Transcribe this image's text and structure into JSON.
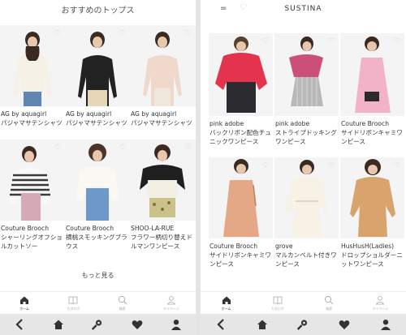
{
  "left": {
    "title": "おすすめのトップス",
    "products": [
      {
        "brand": "AG by aquagirl",
        "name": "パジャマサテンシャツ"
      },
      {
        "brand": "AG by aquagirl",
        "name": "パジャマサテンシャツ"
      },
      {
        "brand": "AG by aquagirl",
        "name": "パジャマサテンシャツ"
      },
      {
        "brand": "Couture Brooch",
        "name": "シャーリングオフショルカットソー"
      },
      {
        "brand": "Couture Brooch",
        "name": "横桃スモッキングブラウス"
      },
      {
        "brand": "SHOO-LA-RUE",
        "name": "フラワー柄切り替えドルマンワンピース"
      }
    ],
    "more_label": "もっと見る",
    "tabs": [
      {
        "label": "ホーム",
        "icon": "home-icon",
        "active": true
      },
      {
        "label": "カタログ",
        "icon": "book-icon",
        "active": false
      },
      {
        "label": "検索",
        "icon": "search-icon",
        "active": false
      },
      {
        "label": "マイページ",
        "icon": "user-icon",
        "active": false
      }
    ]
  },
  "right": {
    "menu_symbol": "=",
    "brand": "SUSTINA",
    "products": [
      {
        "brand": "pink adobe",
        "name": "バックリボン配色チュニックワンピース"
      },
      {
        "brand": "pink adobe",
        "name": "ストライプドッキングワンピース"
      },
      {
        "brand": "Couture Brooch",
        "name": "サイドリボンキャミワンピース"
      },
      {
        "brand": "Couture Brooch",
        "name": "サイドリボンキャミワンピース"
      },
      {
        "brand": "grove",
        "name": "マルカンベルト付きワンピース"
      },
      {
        "brand": "HusHusH(Ladies)",
        "name": "ドロップショルダーニットワンピース"
      }
    ],
    "tabs": [
      {
        "label": "ホーム",
        "icon": "home-icon",
        "active": true
      },
      {
        "label": "カタログ",
        "icon": "book-icon",
        "active": false
      },
      {
        "label": "検索",
        "icon": "search-icon",
        "active": false
      },
      {
        "label": "マイページ",
        "icon": "user-icon",
        "active": false
      }
    ]
  },
  "system_bar": [
    "back-icon",
    "home-icon",
    "key-icon",
    "heart-icon",
    "user-icon"
  ],
  "colors": {
    "heart": "#efb8c4",
    "system_bar": "#e6e6e6"
  }
}
